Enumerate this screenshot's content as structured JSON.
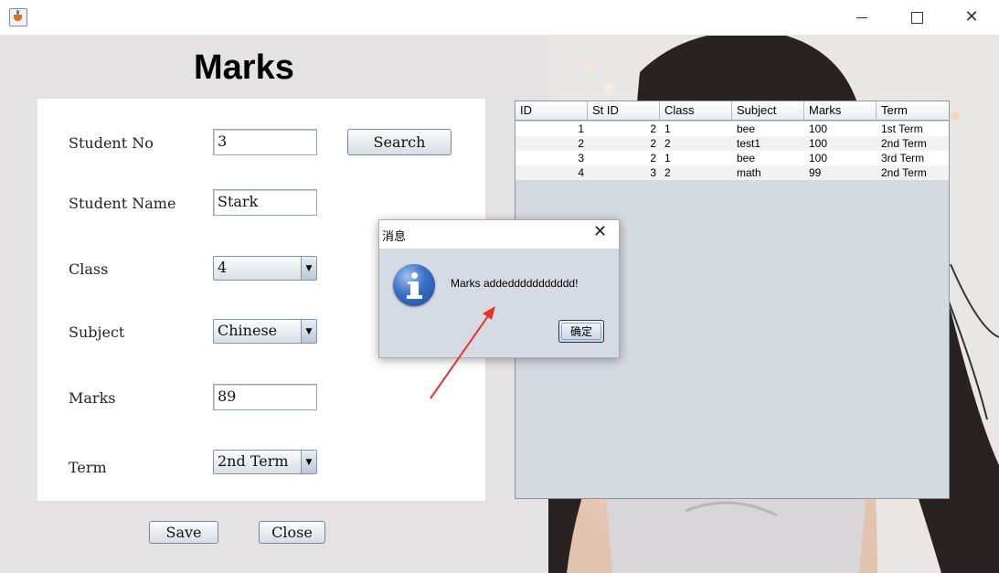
{
  "window": {
    "icon": "java-cup-icon",
    "min_icon": "minimize-icon",
    "max_icon": "maximize-icon",
    "close_glyph": "✕"
  },
  "page": {
    "title": "Marks"
  },
  "form": {
    "student_no_label": "Student No",
    "student_no_value": "3",
    "search_button": "Search",
    "student_name_label": "Student Name",
    "student_name_value": "Stark",
    "class_label": "Class",
    "class_value": "4",
    "subject_label": "Subject",
    "subject_value": "Chinese",
    "marks_label": "Marks",
    "marks_value": "89",
    "term_label": "Term",
    "term_value": "2nd Term",
    "dropdown_arrow": "▼",
    "save_button": "Save",
    "close_button": "Close"
  },
  "table": {
    "columns": [
      "ID",
      "St ID",
      "Class",
      "Subject",
      "Marks",
      "Term"
    ],
    "rows": [
      [
        "1",
        "2",
        "1",
        "bee",
        "100",
        "1st Term"
      ],
      [
        "2",
        "2",
        "2",
        "test1",
        "100",
        "2nd Term"
      ],
      [
        "3",
        "2",
        "1",
        "bee",
        "100",
        "3rd Term"
      ],
      [
        "4",
        "3",
        "2",
        "math",
        "99",
        "2nd Term"
      ]
    ]
  },
  "dialog": {
    "title": "消息",
    "close_glyph": "✕",
    "icon": "information-icon",
    "message": "Marks addeddddddddddd!",
    "ok_button": "确定"
  },
  "colors": {
    "content_bg": "#e4e2e3",
    "table_bg": "#d5d9e0",
    "dialog_bg": "#d6dbe3",
    "annotation_arrow": "#e8332a"
  }
}
